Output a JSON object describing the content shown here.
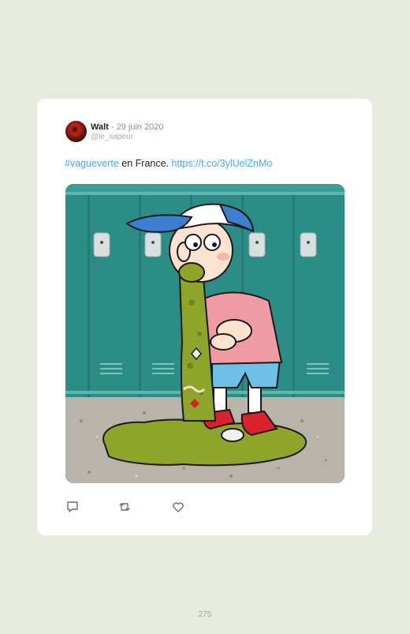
{
  "tweet": {
    "author_name": "Walt",
    "date": " - 29 juin 2020",
    "handle": "@le_sapeur",
    "text_hashtag": "#vagueverte",
    "text_body": " en France. ",
    "text_link": "https://t.co/3ylUelZnMo"
  },
  "actions": {
    "reply_icon": "speech-bubble",
    "retweet_icon": "retweet-arrows",
    "like_icon": "heart-outline"
  },
  "page": {
    "number": "275"
  },
  "colors": {
    "page_background": "#e6ebdd",
    "link": "#4aa8e8",
    "lockers": "#2a8c86",
    "vomit": "#8ea52a"
  }
}
